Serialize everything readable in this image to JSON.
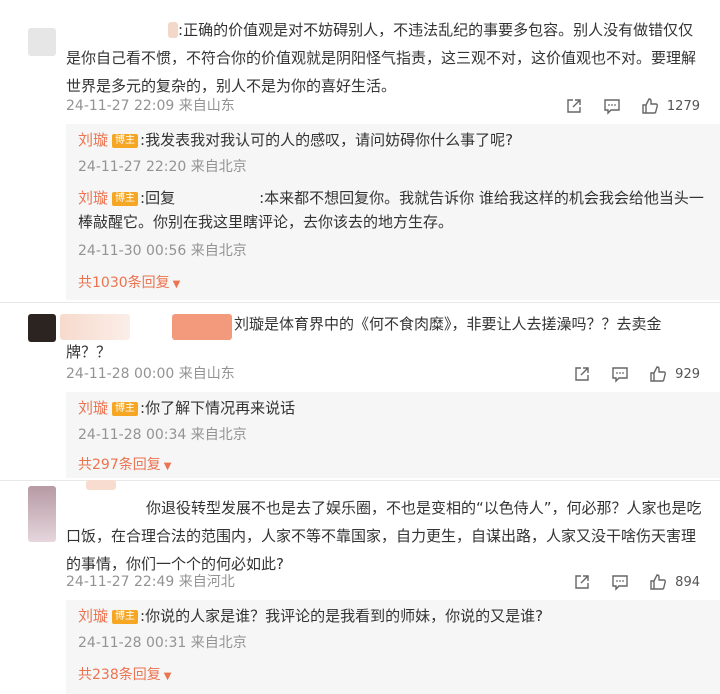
{
  "comments": [
    {
      "text_lines": [
        "正确的价值观是对不妨碍别人，不违法乱纪的事要多包容。别人没有做错仅仅",
        "是你自己看不惯，不符合你的价值观就是阴阳怪气指责，这三观不对，这价值观也不对。要理解",
        "世界是多元的复杂的，别人不是为你的喜好生活。"
      ],
      "text_prefix": ":",
      "meta": "24-11-27 22:09 来自山东",
      "likes": "1279",
      "replies": [
        {
          "author": "刘璇",
          "badge": "博主",
          "text": ":我发表我对我认可的人的感叹，请问妨碍你什么事了呢?",
          "meta": "24-11-27 22:20 来自北京"
        },
        {
          "author": "刘璇",
          "badge": "博主",
          "text_a": ":回复",
          "text_b": ":本来都不想回复你。我就告诉你 谁给我这样的机会我会给他当头一",
          "text_c": "棒敲醒它。你别在我这里瞎评论，去你该去的地方生存。",
          "meta": "24-11-30 00:56 来自北京"
        }
      ],
      "more": "共1030条回复"
    },
    {
      "text_lines": [
        "刘璇是体育界中的《何不食肉糜》，非要让人去搓澡吗？？去卖金",
        "牌？？"
      ],
      "meta": "24-11-28 00:00 来自山东",
      "likes": "929",
      "replies": [
        {
          "author": "刘璇",
          "badge": "博主",
          "text": ":你了解下情况再来说话",
          "meta": "24-11-28 00:34 来自北京"
        }
      ],
      "more": "共297条回复"
    },
    {
      "text_lines": [
        "你退役转型发展不也是去了娱乐圈，不也是变相的“以色侍人”，何必那？人家也是吃",
        "口饭，在合理合法的范围内，人家不等不靠国家，自力更生，自谋出路，人家又没干啥伤天害理",
        "的事情，你们一个个的何必如此?"
      ],
      "meta": "24-11-27 22:49 来自河北",
      "likes": "894",
      "replies": [
        {
          "author": "刘璇",
          "badge": "博主",
          "text": ":你说的人家是谁？我评论的是我看到的师妹，你说的又是谁?",
          "meta": "24-11-28 00:31 来自北京"
        }
      ],
      "more": "共238条回复"
    }
  ],
  "icons": {
    "share": "share-icon",
    "comment": "comment-icon",
    "like": "like-icon",
    "more_arrow": "caret-down-icon"
  },
  "colors": {
    "author": "#eb7350",
    "badge": "#f5a623",
    "meta": "#939393",
    "reply_bg": "#f6f6f6"
  }
}
